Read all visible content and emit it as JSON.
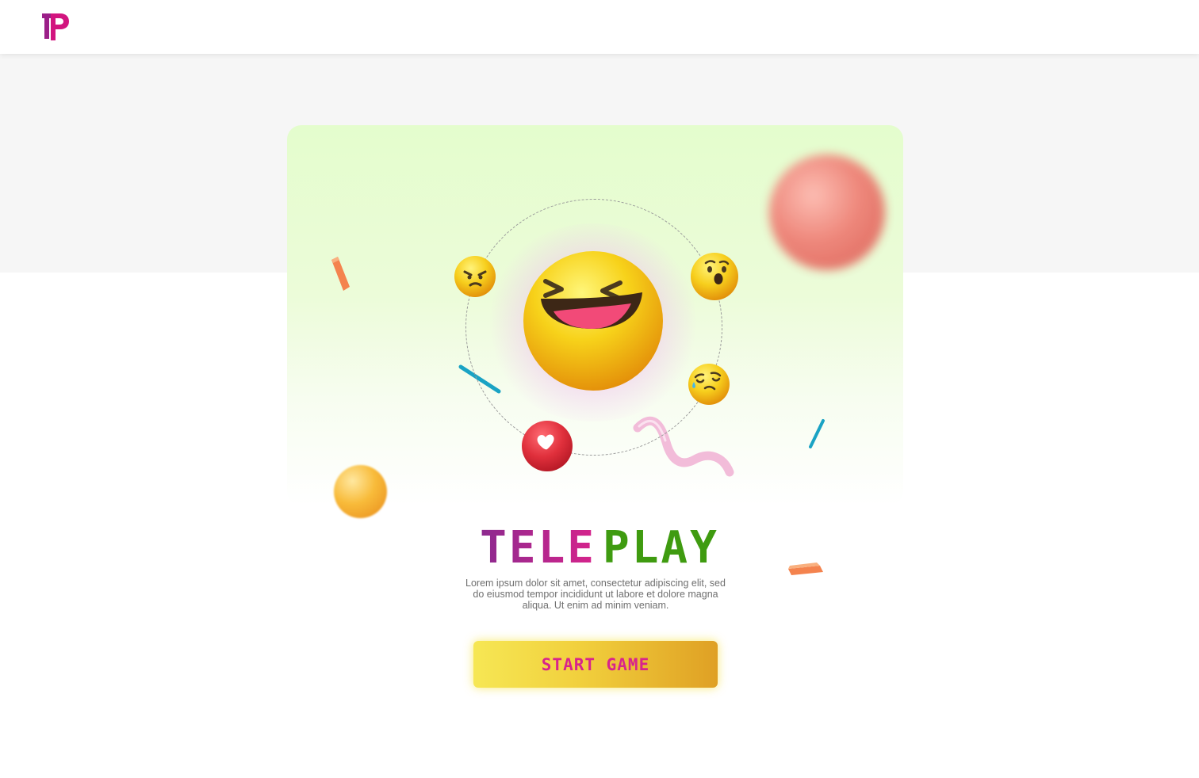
{
  "header": {
    "logo_icon": "teleplay-logo-icon",
    "brand_colors": [
      "#d2157f",
      "#9b1f88"
    ]
  },
  "game": {
    "title_part1": "TELE",
    "title_part2": "PLAY",
    "title_colors": {
      "tele_start": "#8c2a8f",
      "tele_end": "#d7248c",
      "play": "#3f9b10"
    },
    "description": "Lorem ipsum dolor sit amet, consectetur adipiscing elit, sed do eiusmod tempor incididunt ut labore et dolore magna aliqua. Ut enim ad minim veniam.",
    "start_button_label": "START GAME",
    "start_button_text_color": "#d8248c"
  },
  "decorations": {
    "center_emoji": "laughing-emoji-icon",
    "orbit_emojis": [
      "angry-emoji-icon",
      "surprised-emoji-icon",
      "crying-emoji-icon",
      "heart-icon"
    ]
  }
}
